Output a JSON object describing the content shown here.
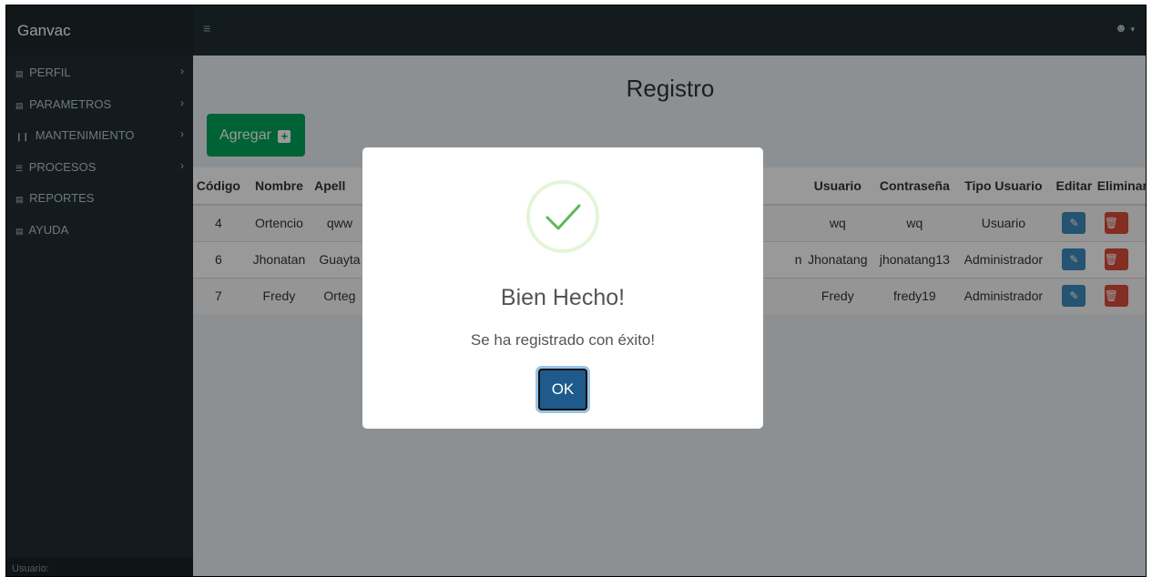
{
  "app": {
    "brand": "Ganvac",
    "menu_icon": "hamburger-icon",
    "user_icon": "user-icon"
  },
  "sidebar": {
    "items": [
      {
        "label": "PERFIL",
        "icon": "grid-icon"
      },
      {
        "label": "PARAMETROS",
        "icon": "grid-icon"
      },
      {
        "label": "MANTENIMIENTO",
        "icon": "columns-icon"
      },
      {
        "label": "PROCESOS",
        "icon": "list-icon"
      },
      {
        "label": "REPORTES",
        "icon": "grid-icon"
      },
      {
        "label": "AYUDA",
        "icon": "grid-icon"
      }
    ],
    "footer": "Usuario:"
  },
  "main": {
    "title": "Registro",
    "add_label": "Agregar",
    "table": {
      "columns": [
        "Código",
        "Nombre",
        "Apell",
        "Usuario",
        "Contraseña",
        "Tipo Usuario",
        "Editar",
        "Eliminar"
      ],
      "rows": [
        {
          "codigo": "4",
          "nombre": "Ortencio",
          "apellido": "qww",
          "hidden": "",
          "usuario": "wq",
          "contrasena": "wq",
          "tipo": "Usuario"
        },
        {
          "codigo": "6",
          "nombre": "Jhonatan",
          "apellido": "Guayta",
          "hidden": "n",
          "usuario": "Jhonatang",
          "contrasena": "jhonatang13",
          "tipo": "Administrador"
        },
        {
          "codigo": "7",
          "nombre": "Fredy",
          "apellido": "Orteg",
          "hidden": "",
          "usuario": "Fredy",
          "contrasena": "fredy19",
          "tipo": "Administrador"
        }
      ]
    }
  },
  "modal": {
    "icon": "success-check-icon",
    "title": "Bien Hecho!",
    "text": "Se ha registrado con éxito!",
    "ok_label": "OK"
  },
  "colors": {
    "sidebar": "#222d32",
    "success": "#00a65a",
    "primary": "#3c8dbc",
    "danger": "#dd4b39",
    "check": "#5cb85c"
  }
}
